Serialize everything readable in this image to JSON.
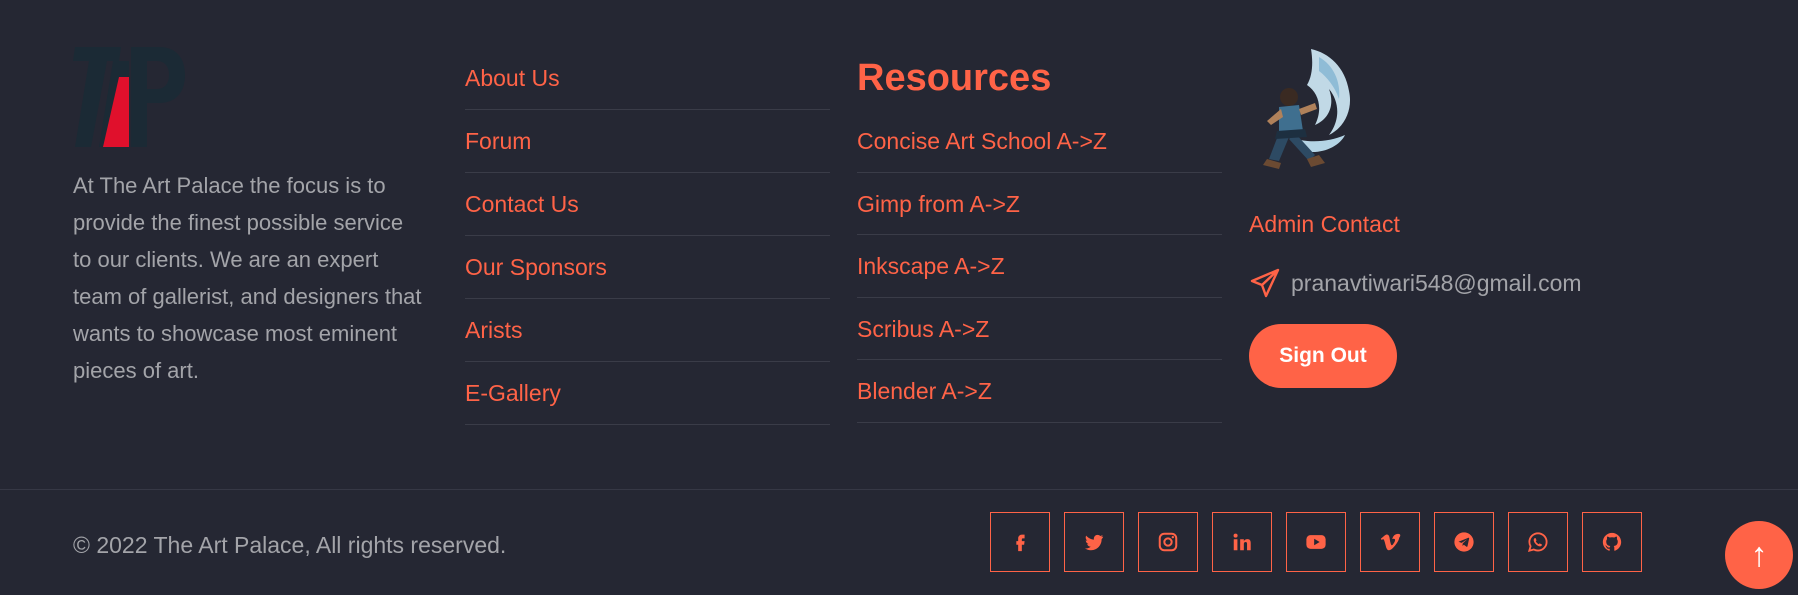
{
  "about": {
    "logo_text": "TAP",
    "text": "At The Art Palace the focus is to provide the finest possible service to our clients. We are an expert team of gallerist, and designers that wants to showcase most eminent pieces of art."
  },
  "links": [
    {
      "label": "About Us"
    },
    {
      "label": "Forum"
    },
    {
      "label": "Contact Us"
    },
    {
      "label": "Our Sponsors"
    },
    {
      "label": "Arists"
    },
    {
      "label": "E-Gallery"
    }
  ],
  "resources": {
    "title": "Resources",
    "items": [
      {
        "label": "Concise Art School A->Z"
      },
      {
        "label": "Gimp from A->Z"
      },
      {
        "label": "Inkscape A->Z"
      },
      {
        "label": "Scribus A->Z"
      },
      {
        "label": "Blender A->Z"
      }
    ]
  },
  "contact": {
    "title": "Admin Contact",
    "email": "pranavtiwari548@gmail.com",
    "signout_label": "Sign Out"
  },
  "bottom": {
    "copyright": "© 2022 The Art Palace, All rights reserved.",
    "socials": [
      "facebook-icon",
      "twitter-icon",
      "instagram-icon",
      "linkedin-icon",
      "youtube-icon",
      "vimeo-icon",
      "telegram-icon",
      "whatsapp-icon",
      "github-icon"
    ],
    "to_top": "↑"
  },
  "colors": {
    "background": "#252733",
    "accent": "#ff6347",
    "text": "#a3a4a9",
    "logo_dark": "#1b2a35",
    "logo_red": "#e0102c"
  }
}
